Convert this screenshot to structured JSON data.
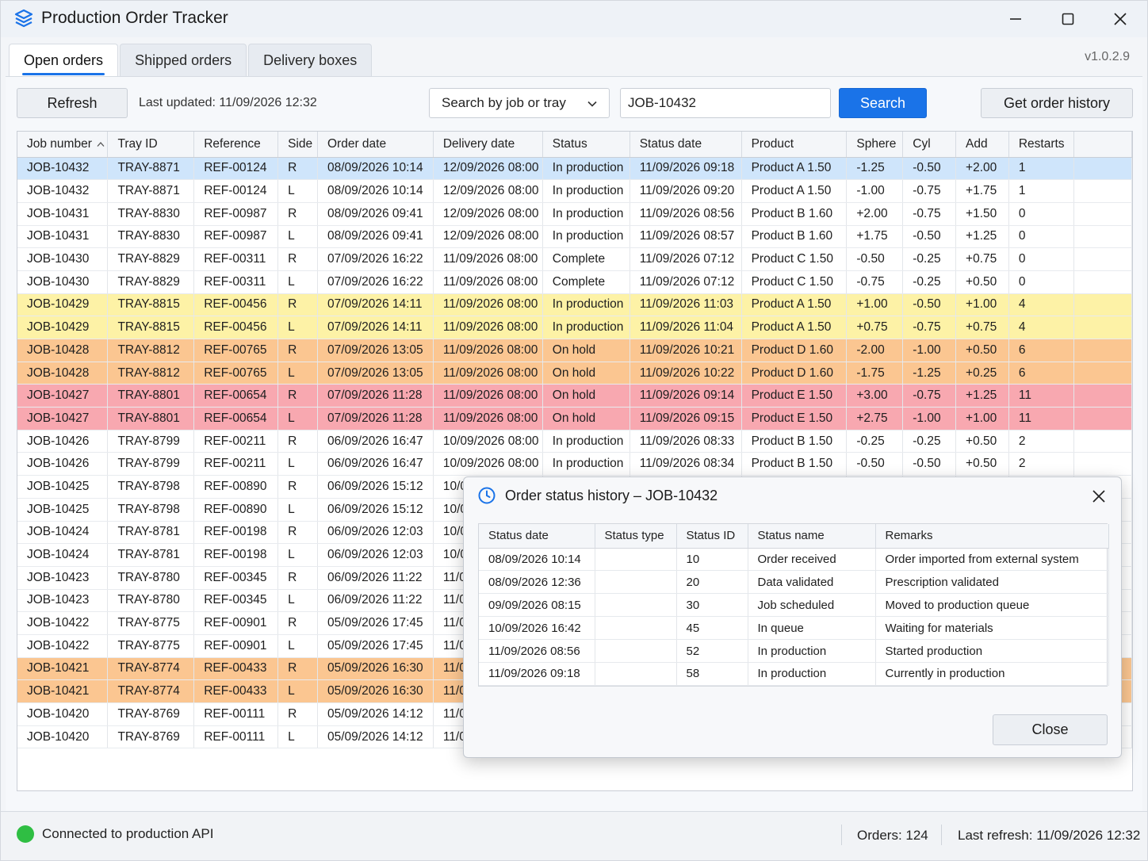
{
  "window": {
    "title": "Production Order Tracker",
    "version": "v1.0.2.9"
  },
  "tabs": [
    {
      "label": "Open orders",
      "active": true
    },
    {
      "label": "Shipped orders",
      "active": false
    },
    {
      "label": "Delivery boxes",
      "active": false
    }
  ],
  "toolbar": {
    "refresh_label": "Refresh",
    "last_updated": "Last updated: 11/09/2026 12:32",
    "search_mode": "Search by job or tray",
    "search_value": "JOB-10432",
    "search_label": "Search",
    "history_label": "Get order history"
  },
  "grid": {
    "columns": [
      "Job number",
      "Tray ID",
      "Reference",
      "Side",
      "Order date",
      "Delivery date",
      "Status",
      "Status date",
      "Product",
      "Sphere",
      "Cyl",
      "Add",
      "Restarts"
    ],
    "rows": [
      {
        "hl": "sel",
        "cells": [
          "JOB-10432",
          "TRAY-8871",
          "REF-00124",
          "R",
          "08/09/2026 10:14",
          "12/09/2026 08:00",
          "In production",
          "11/09/2026 09:18",
          "Product A 1.50",
          "-1.25",
          "-0.50",
          "+2.00",
          "1"
        ]
      },
      {
        "hl": "",
        "cells": [
          "JOB-10432",
          "TRAY-8871",
          "REF-00124",
          "L",
          "08/09/2026 10:14",
          "12/09/2026 08:00",
          "In production",
          "11/09/2026 09:20",
          "Product A 1.50",
          "-1.00",
          "-0.75",
          "+1.75",
          "1"
        ]
      },
      {
        "hl": "",
        "cells": [
          "JOB-10431",
          "TRAY-8830",
          "REF-00987",
          "R",
          "08/09/2026 09:41",
          "12/09/2026 08:00",
          "In production",
          "11/09/2026 08:56",
          "Product B 1.60",
          "+2.00",
          "-0.75",
          "+1.50",
          "0"
        ]
      },
      {
        "hl": "",
        "cells": [
          "JOB-10431",
          "TRAY-8830",
          "REF-00987",
          "L",
          "08/09/2026 09:41",
          "12/09/2026 08:00",
          "In production",
          "11/09/2026 08:57",
          "Product B 1.60",
          "+1.75",
          "-0.50",
          "+1.25",
          "0"
        ]
      },
      {
        "hl": "",
        "cells": [
          "JOB-10430",
          "TRAY-8829",
          "REF-00311",
          "R",
          "07/09/2026 16:22",
          "11/09/2026 08:00",
          "Complete",
          "11/09/2026 07:12",
          "Product C 1.50",
          "-0.50",
          "-0.25",
          "+0.75",
          "0"
        ]
      },
      {
        "hl": "",
        "cells": [
          "JOB-10430",
          "TRAY-8829",
          "REF-00311",
          "L",
          "07/09/2026 16:22",
          "11/09/2026 08:00",
          "Complete",
          "11/09/2026 07:12",
          "Product C 1.50",
          "-0.75",
          "-0.25",
          "+0.50",
          "0"
        ]
      },
      {
        "hl": "yellow",
        "cells": [
          "JOB-10429",
          "TRAY-8815",
          "REF-00456",
          "R",
          "07/09/2026 14:11",
          "11/09/2026 08:00",
          "In production",
          "11/09/2026 11:03",
          "Product A 1.50",
          "+1.00",
          "-0.50",
          "+1.00",
          "4"
        ]
      },
      {
        "hl": "yellow",
        "cells": [
          "JOB-10429",
          "TRAY-8815",
          "REF-00456",
          "L",
          "07/09/2026 14:11",
          "11/09/2026 08:00",
          "In production",
          "11/09/2026 11:04",
          "Product A 1.50",
          "+0.75",
          "-0.75",
          "+0.75",
          "4"
        ]
      },
      {
        "hl": "orange",
        "cells": [
          "JOB-10428",
          "TRAY-8812",
          "REF-00765",
          "R",
          "07/09/2026 13:05",
          "11/09/2026 08:00",
          "On hold",
          "11/09/2026 10:21",
          "Product D 1.60",
          "-2.00",
          "-1.00",
          "+0.50",
          "6"
        ]
      },
      {
        "hl": "orange",
        "cells": [
          "JOB-10428",
          "TRAY-8812",
          "REF-00765",
          "L",
          "07/09/2026 13:05",
          "11/09/2026 08:00",
          "On hold",
          "11/09/2026 10:22",
          "Product D 1.60",
          "-1.75",
          "-1.25",
          "+0.25",
          "6"
        ]
      },
      {
        "hl": "red",
        "cells": [
          "JOB-10427",
          "TRAY-8801",
          "REF-00654",
          "R",
          "07/09/2026 11:28",
          "11/09/2026 08:00",
          "On hold",
          "11/09/2026 09:14",
          "Product E 1.50",
          "+3.00",
          "-0.75",
          "+1.25",
          "11"
        ]
      },
      {
        "hl": "red",
        "cells": [
          "JOB-10427",
          "TRAY-8801",
          "REF-00654",
          "L",
          "07/09/2026 11:28",
          "11/09/2026 08:00",
          "On hold",
          "11/09/2026 09:15",
          "Product E 1.50",
          "+2.75",
          "-1.00",
          "+1.00",
          "11"
        ]
      },
      {
        "hl": "",
        "cells": [
          "JOB-10426",
          "TRAY-8799",
          "REF-00211",
          "R",
          "06/09/2026 16:47",
          "10/09/2026 08:00",
          "In production",
          "11/09/2026 08:33",
          "Product B 1.50",
          "-0.25",
          "-0.25",
          "+0.50",
          "2"
        ]
      },
      {
        "hl": "",
        "cells": [
          "JOB-10426",
          "TRAY-8799",
          "REF-00211",
          "L",
          "06/09/2026 16:47",
          "10/09/2026 08:00",
          "In production",
          "11/09/2026 08:34",
          "Product B 1.50",
          "-0.50",
          "-0.50",
          "+0.50",
          "2"
        ]
      },
      {
        "hl": "",
        "cells": [
          "JOB-10425",
          "TRAY-8798",
          "REF-00890",
          "R",
          "06/09/2026 15:12",
          "10/0",
          "",
          "",
          "",
          "",
          "",
          "",
          ""
        ]
      },
      {
        "hl": "",
        "cells": [
          "JOB-10425",
          "TRAY-8798",
          "REF-00890",
          "L",
          "06/09/2026 15:12",
          "10/0",
          "",
          "",
          "",
          "",
          "",
          "",
          ""
        ]
      },
      {
        "hl": "",
        "cells": [
          "JOB-10424",
          "TRAY-8781",
          "REF-00198",
          "R",
          "06/09/2026 12:03",
          "10/0",
          "",
          "",
          "",
          "",
          "",
          "",
          ""
        ]
      },
      {
        "hl": "",
        "cells": [
          "JOB-10424",
          "TRAY-8781",
          "REF-00198",
          "L",
          "06/09/2026 12:03",
          "10/0",
          "",
          "",
          "",
          "",
          "",
          "",
          ""
        ]
      },
      {
        "hl": "",
        "cells": [
          "JOB-10423",
          "TRAY-8780",
          "REF-00345",
          "R",
          "06/09/2026 11:22",
          "11/0",
          "",
          "",
          "",
          "",
          "",
          "",
          ""
        ]
      },
      {
        "hl": "",
        "cells": [
          "JOB-10423",
          "TRAY-8780",
          "REF-00345",
          "L",
          "06/09/2026 11:22",
          "11/0",
          "",
          "",
          "",
          "",
          "",
          "",
          ""
        ]
      },
      {
        "hl": "",
        "cells": [
          "JOB-10422",
          "TRAY-8775",
          "REF-00901",
          "R",
          "05/09/2026 17:45",
          "11/0",
          "",
          "",
          "",
          "",
          "",
          "",
          ""
        ]
      },
      {
        "hl": "",
        "cells": [
          "JOB-10422",
          "TRAY-8775",
          "REF-00901",
          "L",
          "05/09/2026 17:45",
          "11/0",
          "",
          "",
          "",
          "",
          "",
          "",
          ""
        ]
      },
      {
        "hl": "orange",
        "cells": [
          "JOB-10421",
          "TRAY-8774",
          "REF-00433",
          "R",
          "05/09/2026 16:30",
          "11/0",
          "",
          "",
          "",
          "",
          "",
          "",
          ""
        ]
      },
      {
        "hl": "orange",
        "cells": [
          "JOB-10421",
          "TRAY-8774",
          "REF-00433",
          "L",
          "05/09/2026 16:30",
          "11/0",
          "",
          "",
          "",
          "",
          "",
          "",
          ""
        ]
      },
      {
        "hl": "",
        "cells": [
          "JOB-10420",
          "TRAY-8769",
          "REF-00111",
          "R",
          "05/09/2026 14:12",
          "11/0",
          "",
          "",
          "",
          "",
          "",
          "",
          ""
        ]
      },
      {
        "hl": "",
        "cells": [
          "JOB-10420",
          "TRAY-8769",
          "REF-00111",
          "L",
          "05/09/2026 14:12",
          "11/0",
          "",
          "",
          "",
          "",
          "",
          "",
          ""
        ]
      }
    ]
  },
  "dialog": {
    "title": "Order status history – JOB-10432",
    "columns": [
      "Status date",
      "Status type",
      "Status ID",
      "Status name",
      "Remarks"
    ],
    "rows": [
      [
        "08/09/2026 10:14",
        "",
        "10",
        "Order received",
        "Order imported from external system"
      ],
      [
        "08/09/2026 12:36",
        "",
        "20",
        "Data validated",
        "Prescription validated"
      ],
      [
        "09/09/2026 08:15",
        "",
        "30",
        "Job scheduled",
        "Moved to production queue"
      ],
      [
        "10/09/2026 16:42",
        "",
        "45",
        "In queue",
        "Waiting for materials"
      ],
      [
        "11/09/2026 08:56",
        "",
        "52",
        "In production",
        "Started production"
      ],
      [
        "11/09/2026 09:18",
        "",
        "58",
        "In production",
        "Currently in production"
      ]
    ],
    "close_label": "Close"
  },
  "statusbar": {
    "connection": "Connected to production API",
    "orders": "Orders: 124",
    "last_refresh": "Last refresh: 11/09/2026 12:32",
    "status_color": "#2fbe43"
  },
  "icons": {
    "app": "layers-icon",
    "dialog": "clock-icon"
  },
  "colors": {
    "accent": "#1a73e8",
    "selected_row": "#cfe5fb",
    "yellow_row": "#fdf2a6",
    "orange_row": "#fbc691",
    "red_row": "#f8a8b0"
  }
}
